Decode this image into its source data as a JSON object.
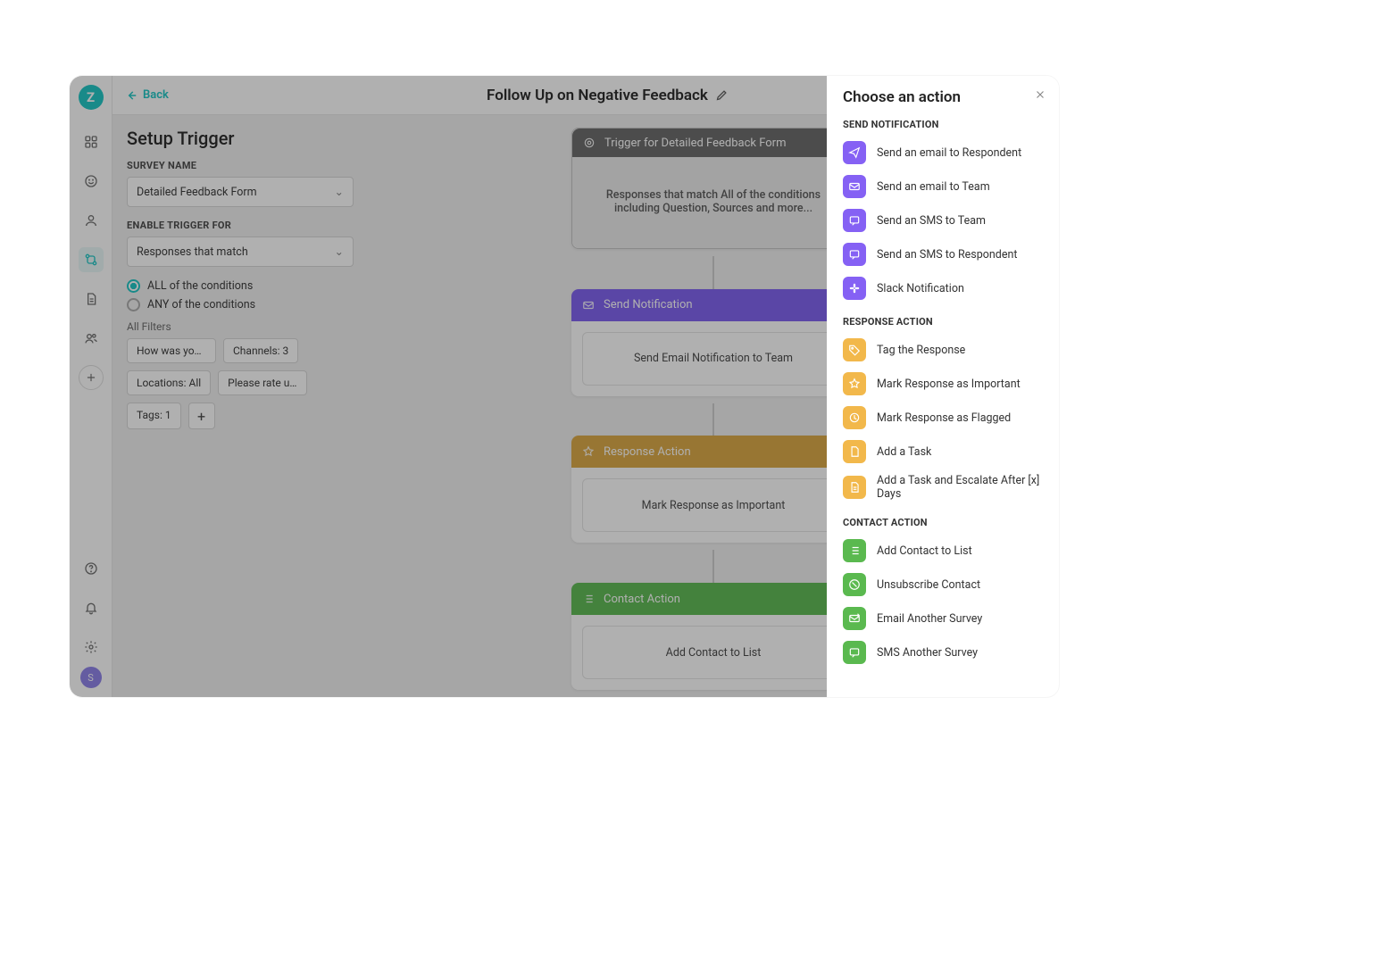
{
  "sidebar": {
    "logo_letter": "Z",
    "avatar_letter": "S"
  },
  "topbar": {
    "back_label": "Back",
    "title": "Follow Up on Negative Feedback"
  },
  "setup": {
    "heading": "Setup Trigger",
    "survey_label": "SURVEY NAME",
    "survey_value": "Detailed Feedback Form",
    "enable_label": "ENABLE TRIGGER FOR",
    "enable_value": "Responses that match",
    "radio_all": "ALL of the conditions",
    "radio_any": "ANY of the conditions",
    "filters_label": "All Filters",
    "chips": [
      "How was your o...",
      "Channels: 3",
      "Locations: All",
      "Please rate us o...",
      "Tags: 1"
    ]
  },
  "flow": {
    "trigger_title": "Trigger for Detailed Feedback Form",
    "trigger_desc": "Responses that match All of the conditions including Question, Sources and more...",
    "notify_title": "Send Notification",
    "notify_desc": "Send Email Notification to Team",
    "response_title": "Response Action",
    "response_desc": "Mark Response as Important",
    "contact_title": "Contact Action",
    "contact_desc": "Add Contact to List"
  },
  "drawer": {
    "title": "Choose an action",
    "sections": [
      {
        "label": "SEND NOTIFICATION",
        "color": "purple",
        "items": [
          {
            "icon": "send",
            "label": "Send an email to Respondent"
          },
          {
            "icon": "mail",
            "label": "Send an email to Team"
          },
          {
            "icon": "sms",
            "label": "Send an SMS to Team"
          },
          {
            "icon": "sms",
            "label": "Send an SMS to Respondent"
          },
          {
            "icon": "slack",
            "label": "Slack Notification"
          }
        ]
      },
      {
        "label": "RESPONSE ACTION",
        "color": "yellow",
        "items": [
          {
            "icon": "tag",
            "label": "Tag the Response"
          },
          {
            "icon": "star",
            "label": "Mark Response as Important"
          },
          {
            "icon": "flag",
            "label": "Mark Response as Flagged"
          },
          {
            "icon": "task",
            "label": "Add a Task"
          },
          {
            "icon": "escalate",
            "label": "Add a Task and Escalate After [x] Days"
          }
        ]
      },
      {
        "label": "CONTACT ACTION",
        "color": "green",
        "items": [
          {
            "icon": "list",
            "label": "Add Contact to List"
          },
          {
            "icon": "unsub",
            "label": "Unsubscribe Contact"
          },
          {
            "icon": "emailsurvey",
            "label": "Email Another Survey"
          },
          {
            "icon": "smssurvey",
            "label": "SMS Another Survey"
          }
        ]
      }
    ]
  }
}
